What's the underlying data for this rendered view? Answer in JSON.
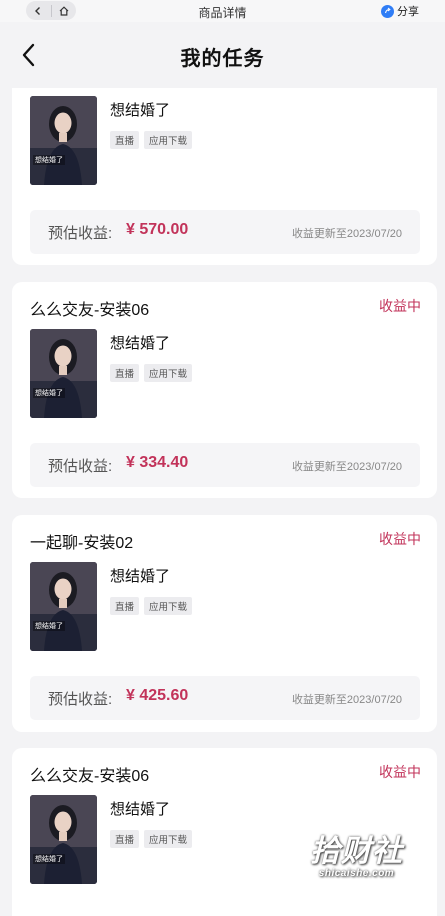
{
  "browser": {
    "title": "商品详情",
    "share_label": "分享"
  },
  "header": {
    "title": "我的任务"
  },
  "earnings_label": "预估收益:",
  "tags": [
    "直播",
    "应用下载"
  ],
  "thumb_caption": "想结婚了",
  "cards": [
    {
      "name": "",
      "status": "",
      "product_title": "想结婚了",
      "amount": "¥ 570.00",
      "update_text": "收益更新至2023/07/20"
    },
    {
      "name": "么么交友-安装06",
      "status": "收益中",
      "product_title": "想结婚了",
      "amount": "¥ 334.40",
      "update_text": "收益更新至2023/07/20"
    },
    {
      "name": "一起聊-安装02",
      "status": "收益中",
      "product_title": "想结婚了",
      "amount": "¥ 425.60",
      "update_text": "收益更新至2023/07/20"
    },
    {
      "name": "么么交友-安装06",
      "status": "收益中",
      "product_title": "想结婚了",
      "amount": "",
      "update_text": ""
    }
  ],
  "watermark": {
    "main": "拾财社",
    "sub": "shicaishe.com"
  },
  "colors": {
    "accent": "#c2335a",
    "background": "#f3f3f5",
    "card": "#ffffff"
  }
}
